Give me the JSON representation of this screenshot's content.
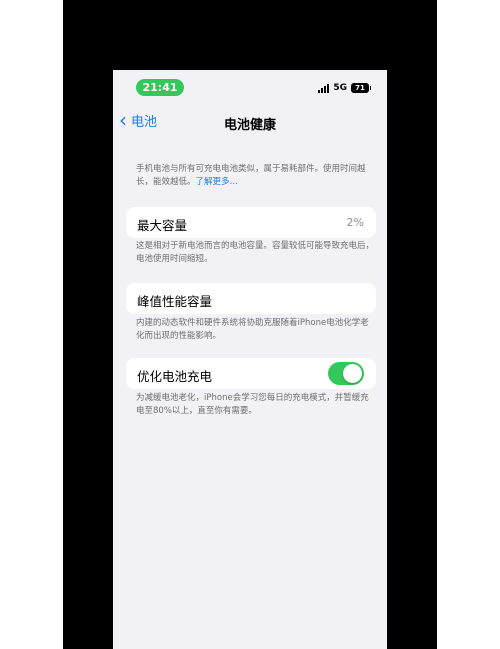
{
  "status": {
    "time": "21:41",
    "network": "5G",
    "battery_level": "71"
  },
  "nav": {
    "back_label": "电池",
    "title": "电池健康"
  },
  "intro": {
    "text": "手机电池与所有可充电电池类似，属于易耗部件。使用时间越长，能效越低。",
    "link": "了解更多…"
  },
  "max_capacity": {
    "label": "最大容量",
    "value": "2%",
    "description": "这是相对于新电池而言的电池容量。容量较低可能导致充电后，电池使用时间缩短。"
  },
  "peak_performance": {
    "label": "峰值性能容量",
    "description": "内建的动态软件和硬件系统将协助克服随着iPhone电池化学老化而出现的性能影响。"
  },
  "optimized_charging": {
    "label": "优化电池充电",
    "enabled": true,
    "description": "为减缓电池老化，iPhone会学习您每日的充电模式，并暂缓充电至80%以上，直至你有需要。"
  },
  "colors": {
    "accent": "#1f7cf0",
    "toggle_on": "#34c759",
    "background": "#f2f2f6"
  }
}
